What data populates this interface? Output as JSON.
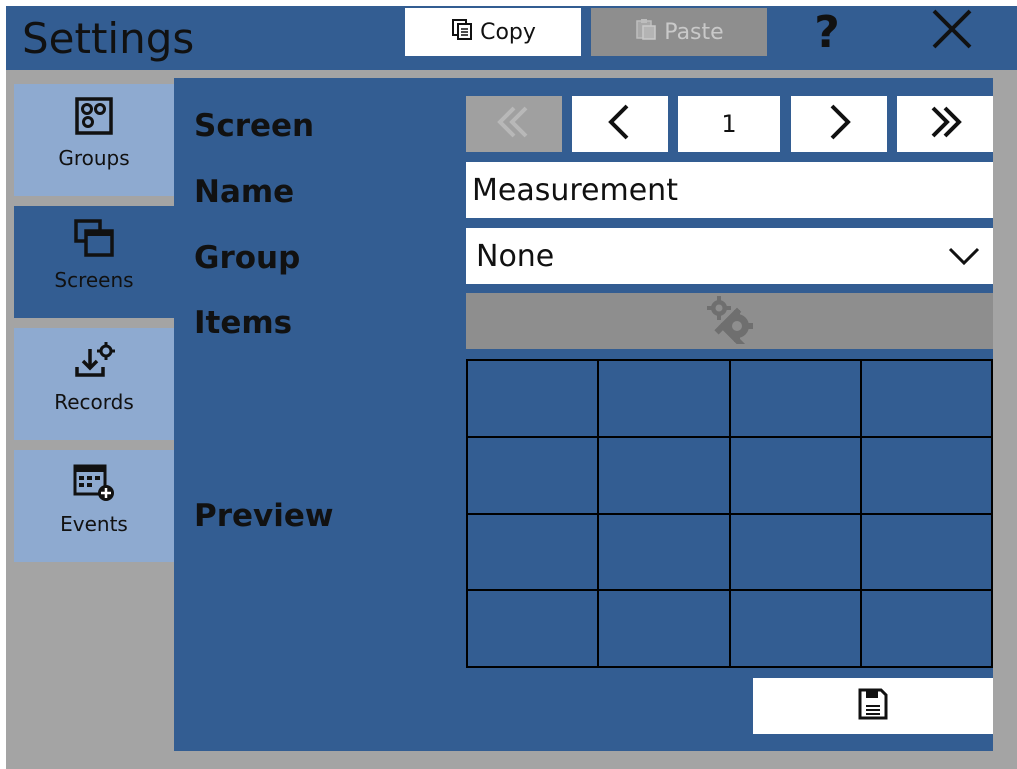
{
  "window": {
    "title": "Settings"
  },
  "toolbar": {
    "copy_label": "Copy",
    "paste_label": "Paste",
    "help_label": "?",
    "icons": [
      "copy-icon",
      "paste-icon",
      "help-icon",
      "close-icon"
    ]
  },
  "sidebar": {
    "items": [
      {
        "label": "Groups",
        "icon": "groups-icon",
        "active": false
      },
      {
        "label": "Screens",
        "icon": "screens-icon",
        "active": true
      },
      {
        "label": "Records",
        "icon": "records-icon",
        "active": false
      },
      {
        "label": "Events",
        "icon": "events-icon",
        "active": false
      }
    ]
  },
  "form": {
    "screen_label": "Screen",
    "name_label": "Name",
    "group_label": "Group",
    "items_label": "Items",
    "preview_label": "Preview",
    "page_number": "1",
    "name_value": "Measurement",
    "group_value": "None",
    "preview_grid": {
      "rows": 4,
      "columns": 4
    }
  },
  "colors": {
    "panel": "#335d92",
    "sidebar_item": "#8eaad0",
    "disabled": "#8e8e8e",
    "background": "#a4a4a4"
  }
}
